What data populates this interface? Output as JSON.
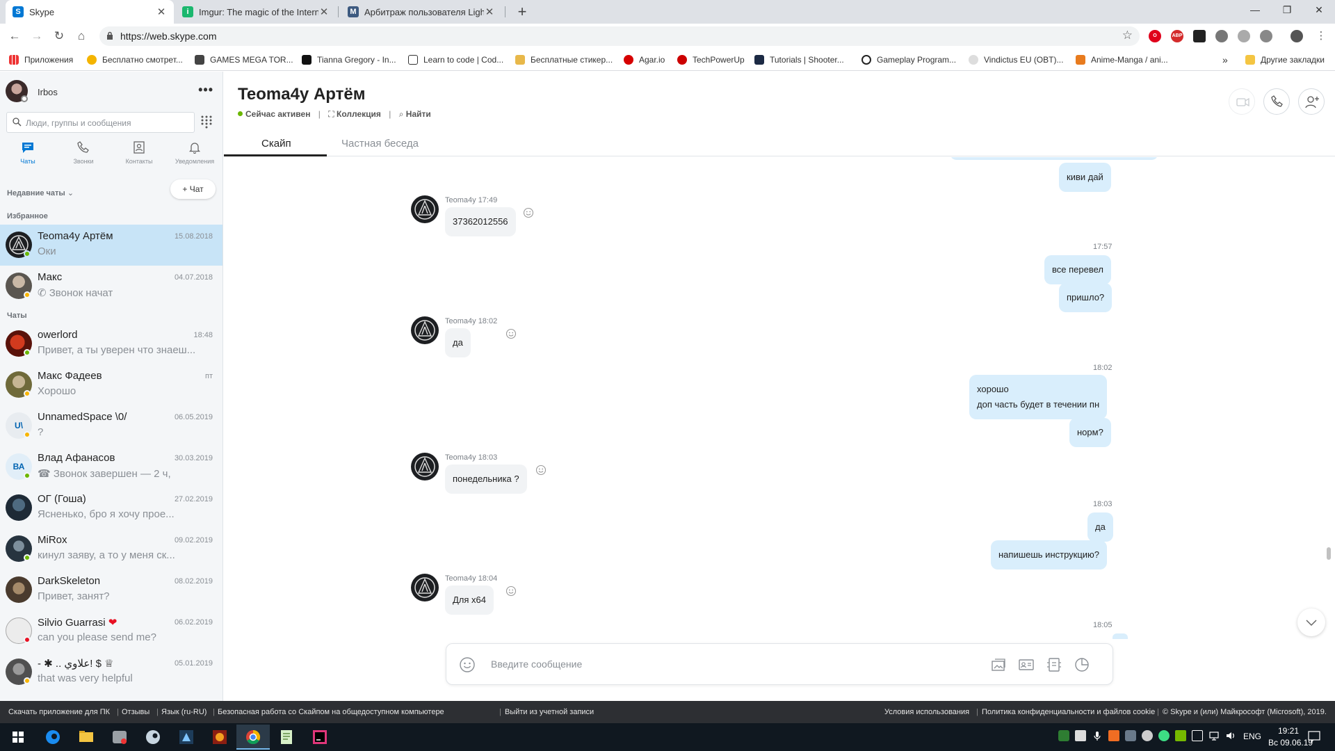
{
  "browser": {
    "tabs": [
      {
        "title": "Skype",
        "favicon": "S",
        "color": "#0078d4"
      },
      {
        "title": "Imgur: The magic of the Internet",
        "favicon": "i",
        "color": "#1bb76e"
      },
      {
        "title": "Арбитраж пользователя LightF",
        "favicon": "M",
        "color": "#3d5a80"
      }
    ],
    "url": "https://web.skype.com",
    "bookmarks": [
      "Приложения",
      "Бесплатно смотрет...",
      "GAMES MEGA TOR...",
      "Tianna Gregory - In...",
      "Learn to code | Cod...",
      "Бесплатные стикер...",
      "Agar.io",
      "TechPowerUp",
      "Tutorials | Shooter...",
      "Gameplay Program...",
      "Vindictus EU (OBT)...",
      "Anime-Manga / ani..."
    ],
    "more_bookmarks": "»",
    "other_bookmarks": "Другие закладки"
  },
  "sidebar": {
    "profile_name": "Irbos",
    "search_placeholder": "Люди, группы и сообщения",
    "nav": [
      {
        "label": "Чаты",
        "icon": "chat-icon"
      },
      {
        "label": "Звонки",
        "icon": "phone-icon"
      },
      {
        "label": "Контакты",
        "icon": "contacts-icon"
      },
      {
        "label": "Уведомления",
        "icon": "bell-icon"
      }
    ],
    "recent_label": "Недавние чаты",
    "new_chat_label": "+ Чат",
    "favorites_label": "Избранное",
    "chats_label": "Чаты",
    "favorites": [
      {
        "name": "Teoma4y Артём",
        "date": "15.08.2018",
        "preview": "Оки",
        "presence": "online",
        "avatar_color": "#1d1f22",
        "selected": true
      },
      {
        "name": "Макс",
        "date": "04.07.2018",
        "preview": "Звонок начат",
        "presence": "away",
        "avatar_color": "#5a5650",
        "call": true
      }
    ],
    "chats": [
      {
        "name": "owerlord",
        "date": "18:48",
        "preview": "Привет, а ты уверен что знаеш...",
        "presence": "online",
        "avatar_color": "#8b1e12"
      },
      {
        "name": "Макс Фадеев",
        "date": "пт",
        "preview": "Хорошо",
        "presence": "away",
        "avatar_color": "#6f6a3a"
      },
      {
        "name": "UnnamedSpace \\0/",
        "date": "06.05.2019",
        "preview": "?",
        "presence": "away",
        "avatar_color": "#e8ecf0",
        "initials": "U\\"
      },
      {
        "name": "Влад Афанасов",
        "date": "30.03.2019",
        "preview": "Звонок завершен — 2 ч,",
        "presence": "online",
        "avatar_color": "#e1eef8",
        "initials": "ВА",
        "call": true
      },
      {
        "name": "ОГ (Гоша)",
        "date": "27.02.2019",
        "preview": "Ясненько, бро я хочу прое...",
        "presence": "offline",
        "avatar_color": "#1e2a36"
      },
      {
        "name": "MiRox",
        "date": "09.02.2019",
        "preview": "кинул заяву, а то у меня ск...",
        "presence": "online",
        "avatar_color": "#27343f"
      },
      {
        "name": "DarkSkeleton",
        "date": "08.02.2019",
        "preview": "Привет, занят?",
        "presence": "none",
        "avatar_color": "#4a3b2e"
      },
      {
        "name": "Silvio Guarrasi",
        "date": "06.02.2019",
        "preview": "can you please send me?",
        "presence": "busy",
        "avatar_color": "#ececec",
        "heart": "❤"
      },
      {
        "name": "- ✱ .. علاوي! $ ♕",
        "date": "05.01.2019",
        "preview": "that was very helpful",
        "presence": "away",
        "avatar_color": "#505050"
      }
    ]
  },
  "conversation": {
    "title": "Teoma4y Артём",
    "status": "Сейчас активен",
    "collection": "Коллекция",
    "find": "Найти",
    "tabs": [
      "Скайп",
      "Частная беседа"
    ],
    "sender_name": "Teoma4y",
    "input_placeholder": "Введите сообщение",
    "messages": [
      {
        "dir": "out",
        "text": "киви дай"
      },
      {
        "dir": "in",
        "header": "Teoma4y 17:49",
        "text": "37362012556"
      },
      {
        "dir": "out",
        "time": "17:57",
        "text": "все перевел"
      },
      {
        "dir": "out",
        "text": "пришло?"
      },
      {
        "dir": "in",
        "header": "Teoma4y 18:02",
        "text": "да"
      },
      {
        "dir": "out",
        "time": "18:02",
        "text": "хорошо",
        "text2": "доп часть будет в течении пн"
      },
      {
        "dir": "out",
        "text": "норм?"
      },
      {
        "dir": "in",
        "header": "Teoma4y 18:03",
        "text": "понедельника ?"
      },
      {
        "dir": "out",
        "time": "18:03",
        "text": "да"
      },
      {
        "dir": "out",
        "text": "напишешь инструкцию?"
      },
      {
        "dir": "in",
        "header": "Teoma4y 18:04",
        "text": "Для x64"
      },
      {
        "dir": "out",
        "time": "18:05",
        "text": ""
      }
    ]
  },
  "footer": {
    "left": [
      "Скачать приложение для ПК",
      "Отзывы",
      "Язык (ru-RU)",
      "Безопасная работа со Скайпом на общедоступном компьютере",
      "Выйти из учетной записи"
    ],
    "right": [
      "Условия использования",
      "Политика конфиденциальности и файлов cookie",
      "© Skype и (или) Майкрософт (Microsoft), 2019."
    ]
  },
  "taskbar": {
    "lang": "ENG",
    "time": "19:21",
    "date": "Вс 09.06.19"
  },
  "colors": {
    "skype_blue": "#0078d4",
    "selected_chat": "#c8e4f7",
    "outgoing_bubble": "#d9eefc",
    "online": "#6bb700",
    "away": "#f8b500",
    "busy": "#e81123"
  }
}
